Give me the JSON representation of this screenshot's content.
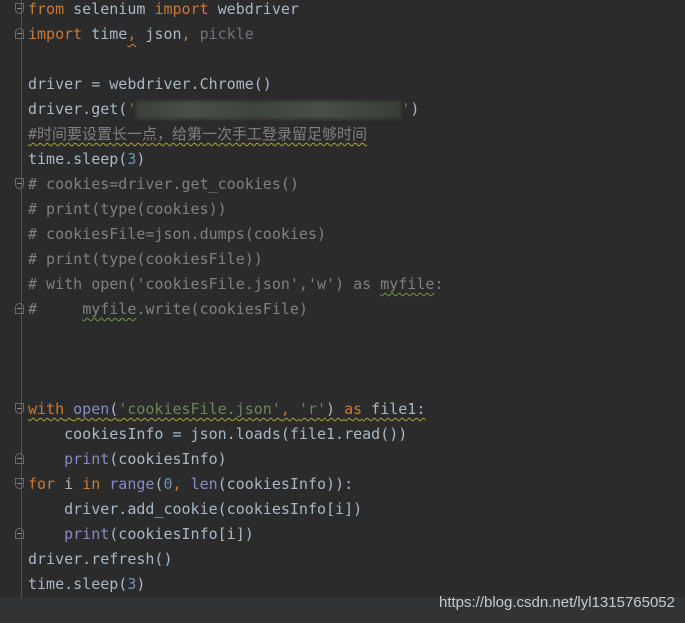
{
  "editor": {
    "theme_colors": {
      "background": "#2b2b2b",
      "keyword": "#cc7832",
      "default": "#a9b7c6",
      "number": "#6897bb",
      "string": "#6a8759",
      "comment": "#808080",
      "builtin": "#8888c6"
    },
    "lines": [
      {
        "fold": "top",
        "tokens": [
          [
            "from",
            "k"
          ],
          [
            " selenium ",
            "d"
          ],
          [
            "import",
            "k"
          ],
          [
            " webdriver",
            "d"
          ]
        ]
      },
      {
        "fold": "bottom",
        "tokens": [
          [
            "import",
            "k"
          ],
          [
            " time",
            "d"
          ],
          [
            ",",
            "k wo"
          ],
          [
            " json",
            "d"
          ],
          [
            ", ",
            "k"
          ],
          [
            "pickle",
            "u"
          ]
        ]
      },
      {
        "tokens": []
      },
      {
        "tokens": [
          [
            "driver = webdriver.Chrome()",
            "d"
          ]
        ]
      },
      {
        "tokens": [
          [
            "driver.get(",
            "d"
          ],
          [
            "'",
            "s"
          ],
          [
            "@blur",
            ""
          ],
          [
            "'",
            "s"
          ],
          [
            ")",
            "d"
          ]
        ]
      },
      {
        "tokens": [
          [
            "#时间要设置长一点，给第一次手工登录留足够时间",
            "c wy"
          ]
        ]
      },
      {
        "tokens": [
          [
            "time.sleep(",
            "d"
          ],
          [
            "3",
            "n"
          ],
          [
            ")",
            "d"
          ]
        ]
      },
      {
        "fold": "top",
        "tokens": [
          [
            "# cookies=driver.get_cookies()",
            "c"
          ]
        ]
      },
      {
        "tokens": [
          [
            "# print(type(cookies))",
            "c"
          ]
        ]
      },
      {
        "tokens": [
          [
            "# cookiesFile=json.dumps(cookies)",
            "c"
          ]
        ]
      },
      {
        "tokens": [
          [
            "# print(type(cookiesFile))",
            "c"
          ]
        ]
      },
      {
        "tokens": [
          [
            "# with open('cookiesFile.json','w') as ",
            "c"
          ],
          [
            "myfile",
            "c wg"
          ],
          [
            ":",
            "c"
          ]
        ]
      },
      {
        "fold": "bottom",
        "tokens": [
          [
            "#     ",
            "c"
          ],
          [
            "myfile",
            "c wg"
          ],
          [
            ".write(cookiesFile)",
            "c"
          ]
        ]
      },
      {
        "tokens": []
      },
      {
        "tokens": []
      },
      {
        "tokens": []
      },
      {
        "fold": "top",
        "tokens": [
          [
            "with",
            "k wy"
          ],
          [
            " ",
            "d wy"
          ],
          [
            "open",
            "b wy"
          ],
          [
            "(",
            "d wy"
          ],
          [
            "'cookiesFile.json'",
            "s wy"
          ],
          [
            ", ",
            "k wy"
          ],
          [
            "'r'",
            "s wy"
          ],
          [
            ") ",
            "d wy"
          ],
          [
            "as",
            "k wy"
          ],
          [
            " file1:",
            "d wy"
          ]
        ]
      },
      {
        "tokens": [
          [
            "    cookiesInfo = json.loads(file1.read())",
            "d"
          ]
        ]
      },
      {
        "fold": "bottom",
        "tokens": [
          [
            "    ",
            "d"
          ],
          [
            "print",
            "b"
          ],
          [
            "(cookiesInfo)",
            "d"
          ]
        ]
      },
      {
        "fold": "top",
        "tokens": [
          [
            "for",
            "k"
          ],
          [
            " i ",
            "d"
          ],
          [
            "in",
            "k"
          ],
          [
            " ",
            "d"
          ],
          [
            "range",
            "b"
          ],
          [
            "(",
            "d"
          ],
          [
            "0",
            "n"
          ],
          [
            ", ",
            "k"
          ],
          [
            "len",
            "b"
          ],
          [
            "(cookiesInfo)):",
            "d"
          ]
        ]
      },
      {
        "tokens": [
          [
            "    driver.add_cookie(cookiesInfo[i])",
            "d"
          ]
        ]
      },
      {
        "fold": "bottom",
        "tokens": [
          [
            "    ",
            "d"
          ],
          [
            "print",
            "b"
          ],
          [
            "(cookiesInfo[i])",
            "d"
          ]
        ]
      },
      {
        "tokens": [
          [
            "driver.refresh()",
            "d"
          ]
        ]
      },
      {
        "tokens": [
          [
            "time.sleep(",
            "d"
          ],
          [
            "3",
            "n"
          ],
          [
            ")",
            "d"
          ]
        ]
      }
    ]
  },
  "watermark": "https://blog.csdn.net/lyl1315765052"
}
